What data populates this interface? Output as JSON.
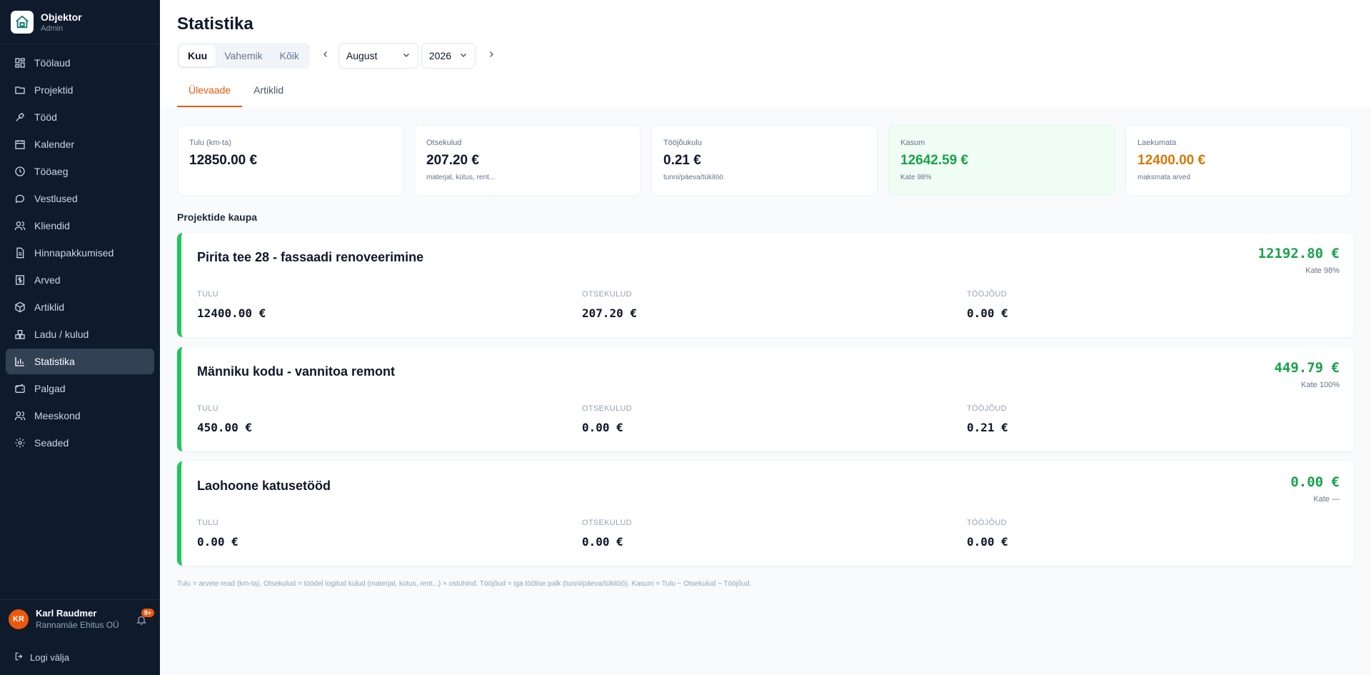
{
  "brand": {
    "name": "Objektor",
    "role": "Admin"
  },
  "nav": [
    {
      "label": "Töölaud",
      "icon": "dashboard-icon"
    },
    {
      "label": "Projektid",
      "icon": "folder-icon"
    },
    {
      "label": "Tööd",
      "icon": "wrench-icon"
    },
    {
      "label": "Kalender",
      "icon": "calendar-icon"
    },
    {
      "label": "Tööaeg",
      "icon": "clock-icon"
    },
    {
      "label": "Vestlused",
      "icon": "chat-icon"
    },
    {
      "label": "Kliendid",
      "icon": "users-icon"
    },
    {
      "label": "Hinnapakkumised",
      "icon": "document-icon"
    },
    {
      "label": "Arved",
      "icon": "invoice-icon"
    },
    {
      "label": "Artiklid",
      "icon": "box-icon"
    },
    {
      "label": "Ladu / kulud",
      "icon": "warehouse-icon"
    },
    {
      "label": "Statistika",
      "icon": "bar-chart-icon",
      "active": true
    },
    {
      "label": "Palgad",
      "icon": "wallet-icon"
    },
    {
      "label": "Meeskond",
      "icon": "team-icon"
    },
    {
      "label": "Seaded",
      "icon": "gear-icon"
    }
  ],
  "user": {
    "initials": "KR",
    "name": "Karl Raudmer",
    "company": "Rannamäe Ehitus OÜ",
    "notifications": "9+"
  },
  "logout": "Logi välja",
  "page": {
    "title": "Statistika",
    "period_modes": [
      "Kuu",
      "Vahemik",
      "Kõik"
    ],
    "active_mode": "Kuu",
    "month": "August",
    "year": "2026",
    "tabs": [
      "Ülevaade",
      "Artiklid"
    ],
    "active_tab": "Ülevaade"
  },
  "kpis": [
    {
      "label": "Tulu (km-ta)",
      "value": "12850.00 €",
      "sub": "",
      "color": "#0f172a"
    },
    {
      "label": "Otsekulud",
      "value": "207.20 €",
      "sub": "materjal, kütus, rent...",
      "color": "#0f172a"
    },
    {
      "label": "Tööjõukulu",
      "value": "0.21 €",
      "sub": "tunni/päeva/tükitöö",
      "color": "#0f172a"
    },
    {
      "label": "Kasum",
      "value": "12642.59 €",
      "sub": "Kate 98%",
      "color": "#16a34a",
      "highlight": true
    },
    {
      "label": "Laekumata",
      "value": "12400.00 €",
      "sub": "maksmata arved",
      "color": "#d97706"
    }
  ],
  "projects_section_title": "Projektide kaupa",
  "metric_labels": {
    "revenue": "TULU",
    "direct": "OTSEKULUD",
    "labor": "TÖÖJÕUD"
  },
  "projects": [
    {
      "name": "Pirita tee 28 - fassaadi renoveerimine",
      "profit": "12192.80 €",
      "margin": "Kate 98%",
      "revenue": "12400.00 €",
      "direct": "207.20 €",
      "labor": "0.00 €"
    },
    {
      "name": "Männiku kodu - vannitoa remont",
      "profit": "449.79 €",
      "margin": "Kate 100%",
      "revenue": "450.00 €",
      "direct": "0.00 €",
      "labor": "0.21 €"
    },
    {
      "name": "Laohoone katusetööd",
      "profit": "0.00 €",
      "margin": "Kate —",
      "revenue": "0.00 €",
      "direct": "0.00 €",
      "labor": "0.00 €"
    }
  ],
  "footnote": "Tulu = arvete read (km-ta). Otsekulud = töödel logitud kulud (materjal, kütus, rent...) × ostuhind. Tööjõud = iga töölise palk (tunni/päeva/tükitöö). Kasum = Tulu − Otsekulud − Tööjõud."
}
